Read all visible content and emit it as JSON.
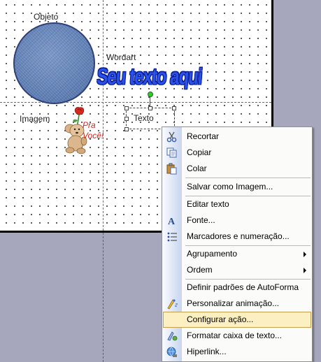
{
  "slide": {
    "labels": {
      "objeto": "Objeto",
      "wordart": "Wordart",
      "imagem": "Imagem",
      "texto": "Texto"
    },
    "wordart_text": "Seu texto aqui",
    "clipart_text_line1": "Pra",
    "clipart_text_line2": "Você!"
  },
  "context_menu": {
    "items": [
      {
        "label": "Recortar",
        "icon": "scissors-icon"
      },
      {
        "label": "Copiar",
        "icon": "copy-icon"
      },
      {
        "label": "Colar",
        "icon": "paste-icon"
      },
      {
        "label": "Salvar como Imagem..."
      },
      {
        "label": "Editar texto"
      },
      {
        "label": "Fonte...",
        "icon": "font-icon"
      },
      {
        "label": "Marcadores e numeração...",
        "icon": "bullets-icon"
      },
      {
        "label": "Agrupamento",
        "submenu": true
      },
      {
        "label": "Ordem",
        "submenu": true
      },
      {
        "label": "Definir padrões de AutoForma"
      },
      {
        "label": "Personalizar animação...",
        "icon": "animation-icon"
      },
      {
        "label": "Configurar ação...",
        "highlighted": true
      },
      {
        "label": "Formatar caixa de texto...",
        "icon": "format-textbox-icon"
      },
      {
        "label": "Hiperlink...",
        "icon": "hyperlink-icon"
      }
    ]
  },
  "colors": {
    "menu_highlight": "#fcf0c3",
    "workspace_bg": "#a6a6bd"
  }
}
